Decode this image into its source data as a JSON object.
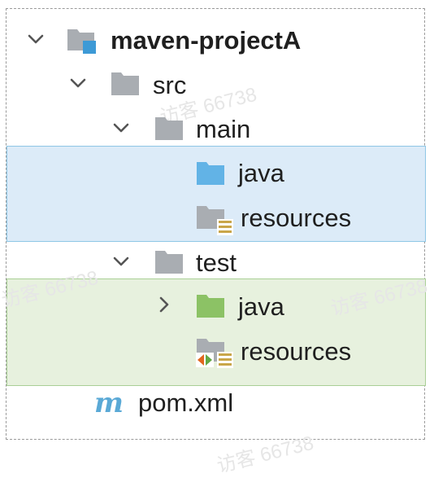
{
  "tree": {
    "project": {
      "label": "maven-projectA",
      "expanded": true,
      "icon": "module-folder-icon"
    },
    "src": {
      "label": "src",
      "expanded": true,
      "icon": "folder-icon"
    },
    "main": {
      "label": "main",
      "expanded": true,
      "icon": "folder-icon"
    },
    "main_java": {
      "label": "java",
      "icon": "source-root-folder-icon",
      "highlight": "#dcebf8"
    },
    "main_resources": {
      "label": "resources",
      "icon": "resources-root-folder-icon"
    },
    "test": {
      "label": "test",
      "expanded": true,
      "icon": "folder-icon"
    },
    "test_java": {
      "label": "java",
      "expanded": false,
      "icon": "test-source-root-folder-icon",
      "highlight": "#e7f1de"
    },
    "test_resources": {
      "label": "resources",
      "icon": "test-resources-root-folder-icon"
    },
    "pom": {
      "label": "pom.xml",
      "icon": "maven-icon"
    }
  },
  "watermark": {
    "text": "访客 66738"
  },
  "colors": {
    "folder": "#a9adb2",
    "source_folder": "#62b3e6",
    "test_folder": "#8cc265",
    "maven_m": "#5aa9d6"
  }
}
